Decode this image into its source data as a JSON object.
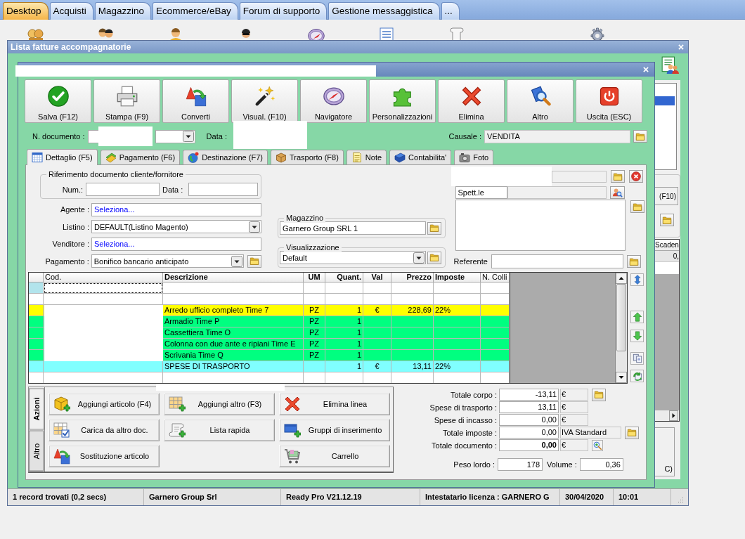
{
  "app_tabs": [
    {
      "label": "Desktop",
      "selected": true
    },
    {
      "label": "Acquisti",
      "selected": false
    },
    {
      "label": "Magazzino",
      "selected": false
    },
    {
      "label": "Ecommerce/eBay",
      "selected": false
    },
    {
      "label": "Forum di supporto",
      "selected": false
    },
    {
      "label": "Gestione messaggistica",
      "selected": false
    },
    {
      "label": "...",
      "selected": false
    }
  ],
  "list_window": {
    "title": "Lista fatture accompagnatorie",
    "side_button": "(F10)",
    "side_table": {
      "column_1": "Scaden",
      "row_1": "0,"
    },
    "side_exit_button": "C)"
  },
  "document_window": {
    "toolbar": [
      "Salva (F12)",
      "Stampa (F9)",
      "Converti",
      "Visual. (F10)",
      "Navigatore",
      "Personalizzazioni",
      "Elimina",
      "Altro",
      "Uscita (ESC)"
    ],
    "header": {
      "number_label": "N. documento :",
      "date_label": "Data :",
      "causale_label": "Causale :",
      "causale": "VENDITA"
    },
    "tabs": [
      {
        "label": "Dettaglio (F5)",
        "selected": true
      },
      {
        "label": "Pagamento (F6)",
        "selected": false
      },
      {
        "label": "Destinazione (F7)",
        "selected": false
      },
      {
        "label": "Trasporto (F8)",
        "selected": false
      },
      {
        "label": "Note",
        "selected": false
      },
      {
        "label": "Contabilita'",
        "selected": false
      },
      {
        "label": "Foto",
        "selected": false
      }
    ],
    "reference": {
      "title": "Riferimento documento cliente/fornitore",
      "number_label": "Num.:",
      "date_label": "Data :"
    },
    "fields": [
      {
        "kind": "lookup",
        "label": "Agente :",
        "value": "Seleziona..."
      },
      {
        "kind": "dropdown",
        "label": "Listino :",
        "value": "DEFAULT(Listino Magento)"
      },
      {
        "kind": "lookup",
        "label": "Venditore :",
        "value": "Seleziona..."
      },
      {
        "kind": "combo",
        "label": "Pagamento :",
        "value": "Bonifico bancario anticipato"
      }
    ],
    "warehouse": {
      "title": "Magazzino",
      "value": "Garnero Group SRL 1"
    },
    "view": {
      "title": "Visualizzazione",
      "value": "Default"
    },
    "recipient": {
      "salutation": "Spett.le",
      "contact_label": "Referente"
    },
    "grid": {
      "columns": [
        {
          "label": "Cod.",
          "bold": false
        },
        {
          "label": "Descrizione",
          "bold": true
        },
        {
          "label": "UM",
          "bold": true
        },
        {
          "label": "Quant.",
          "bold": true
        },
        {
          "label": "Val",
          "bold": true
        },
        {
          "label": "Prezzo",
          "bold": true
        },
        {
          "label": "Imposte",
          "bold": true
        },
        {
          "label": "N. Colli",
          "bold": false
        }
      ],
      "rows": [
        {
          "selected": true,
          "color": "#ffffff"
        },
        {
          "selected": false,
          "color": "#ffffff"
        },
        {
          "selected": false,
          "color": "#ffff00",
          "description": "Arredo ufficio completo Time 7",
          "um": "PZ",
          "quantity": "1",
          "currency": "€",
          "price": "228,69",
          "tax": "22%"
        },
        {
          "selected": false,
          "color": "#00ff80",
          "description": "Armadio Time P",
          "um": "PZ",
          "quantity": "1"
        },
        {
          "selected": false,
          "color": "#00ff80",
          "description": "Cassettiera Time O",
          "um": "PZ",
          "quantity": "1"
        },
        {
          "selected": false,
          "color": "#00ff80",
          "description": "Colonna con due ante e ripiani Time E",
          "um": "PZ",
          "quantity": "1"
        },
        {
          "selected": false,
          "color": "#00ff80",
          "description": "Scrivania Time Q",
          "um": "PZ",
          "quantity": "1"
        },
        {
          "selected": false,
          "color": "#80ffff",
          "description": "SPESE DI TRASPORTO",
          "quantity": "1",
          "currency": "€",
          "price": "13,11",
          "tax": "22%"
        },
        {
          "selected": false,
          "color": "#ffffff"
        }
      ]
    },
    "actions": {
      "tabs": [
        {
          "label": "Azioni",
          "selected": true
        },
        {
          "label": "Altro",
          "selected": false
        }
      ],
      "columns": [
        [
          "Aggiungi articolo (F4)",
          "Carica da altro doc.",
          "Sostituzione articolo"
        ],
        [
          "Aggiungi altro (F3)",
          "Lista rapida"
        ],
        [
          "Elimina linea",
          "Gruppi di inserimento",
          "Carrello"
        ]
      ]
    },
    "totals": [
      {
        "label": "Totale corpo :",
        "value": "-13,11",
        "unit": "€",
        "bold": false
      },
      {
        "label": "Spese di trasporto :",
        "value": "13,11",
        "unit": "€",
        "bold": false
      },
      {
        "label": "Spese di incasso :",
        "value": "0,00",
        "unit": "€",
        "bold": false
      },
      {
        "label": "Totale imposte :",
        "value": "0,00",
        "unit": "IVA Standard",
        "bold": false
      },
      {
        "label": "Totale documento :",
        "value": "0,00",
        "unit": "€",
        "bold": true
      }
    ],
    "weight": {
      "label": "Peso lordo :",
      "value": "178"
    },
    "volume": {
      "label": "Volume :",
      "value": "0,36"
    }
  },
  "status_bar": [
    "1 record trovati (0,2 secs)",
    "Garnero Group Srl",
    "Ready Pro V21.12.19",
    "Intestatario licenza : GARNERO G",
    "30/04/2020",
    "10:01"
  ]
}
